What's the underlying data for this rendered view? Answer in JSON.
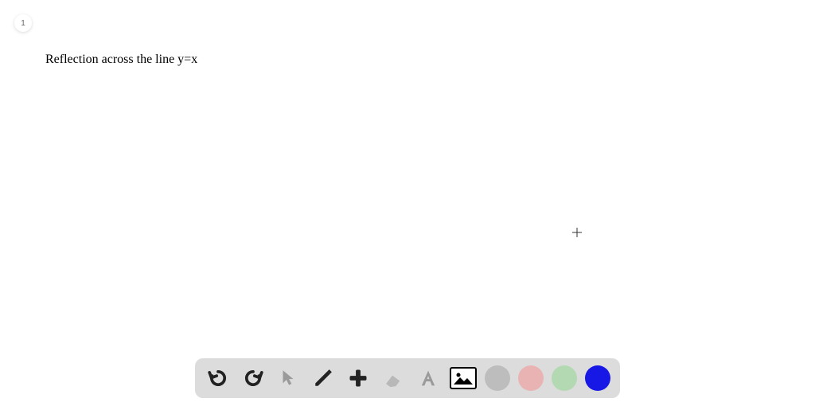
{
  "page": {
    "number": "1"
  },
  "content": {
    "title": "Reflection across the line y=x"
  },
  "toolbar": {
    "tools": {
      "undo": "undo",
      "redo": "redo",
      "pointer": "pointer",
      "pencil": "pencil",
      "add": "add",
      "eraser": "eraser",
      "text": "text",
      "image": "image"
    },
    "colors": {
      "gray": "#bdbdbd",
      "pink": "#e9b3b3",
      "green": "#b3d9b3",
      "blue": "#1818e6"
    }
  }
}
